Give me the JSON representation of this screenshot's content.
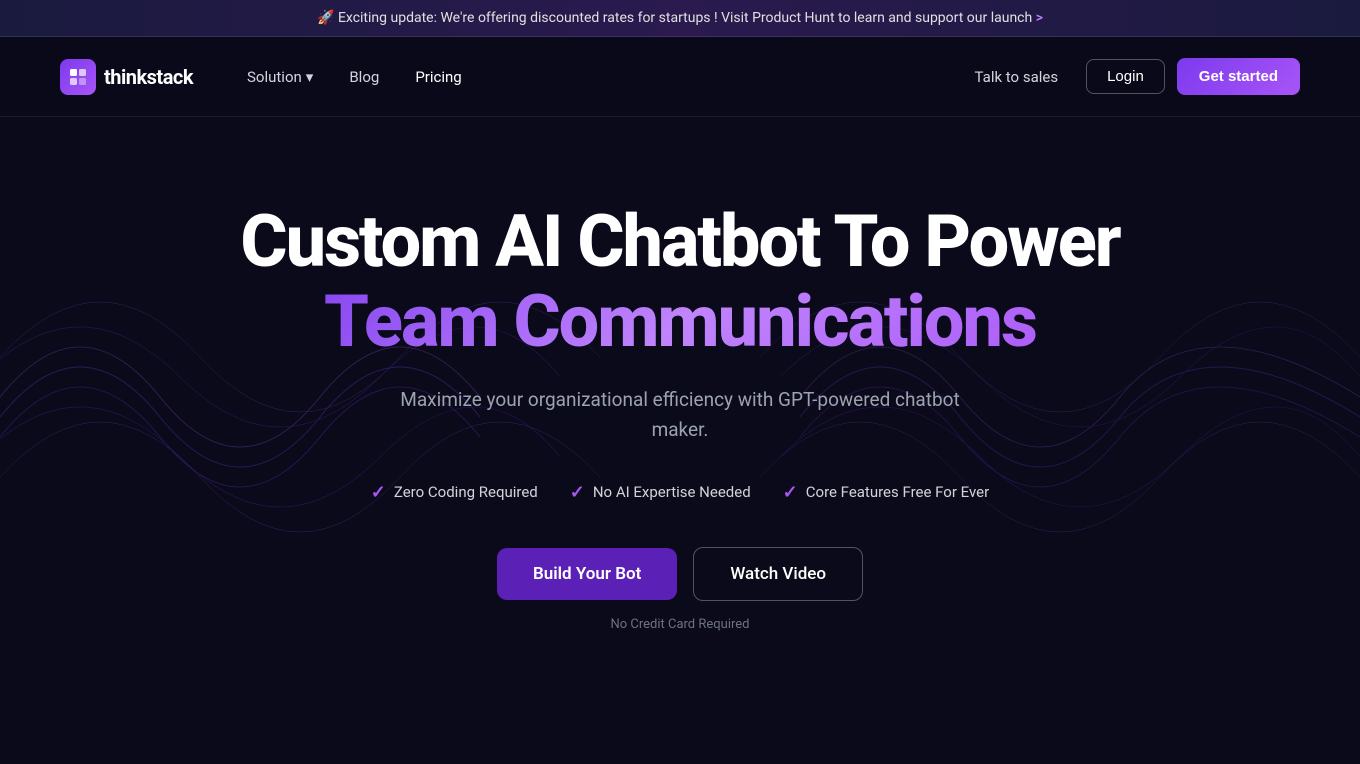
{
  "announcement": {
    "rocket_icon": "🚀",
    "text": "Exciting update: We're offering discounted rates for startups ! Visit Product Hunt to learn and support our launch",
    "cta": ">",
    "link_text": "Visit Product Hunt to learn and support our launch >"
  },
  "navbar": {
    "logo_text": "thinkstack",
    "nav_items": [
      {
        "label": "Solution",
        "has_dropdown": true,
        "active": false
      },
      {
        "label": "Blog",
        "has_dropdown": false,
        "active": false
      },
      {
        "label": "Pricing",
        "has_dropdown": false,
        "active": false
      }
    ],
    "talk_to_sales": "Talk to sales",
    "login": "Login",
    "get_started": "Get started"
  },
  "hero": {
    "title_line1": "Custom AI Chatbot To Power",
    "title_line2": "Team Communications",
    "subtitle": "Maximize your organizational efficiency with GPT-powered chatbot maker.",
    "features": [
      {
        "label": "Zero Coding Required"
      },
      {
        "label": "No AI Expertise Needed"
      },
      {
        "label": "Core Features Free For Ever"
      }
    ],
    "cta_primary": "Build Your Bot",
    "cta_secondary": "Watch Video",
    "no_credit": "No Credit Card Required"
  }
}
